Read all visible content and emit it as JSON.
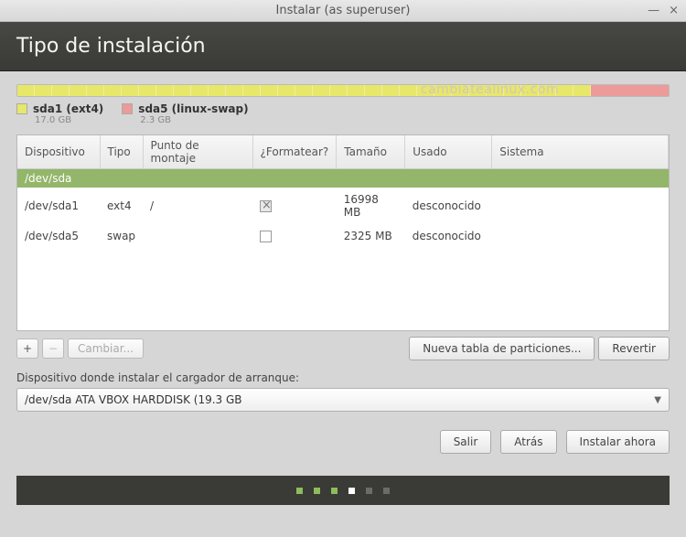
{
  "window": {
    "title": "Instalar (as superuser)"
  },
  "header": {
    "title": "Tipo de instalación"
  },
  "watermark": "cambiatealinux.com",
  "diskBar": {
    "ext4_pct": 88,
    "swap_pct": 12
  },
  "legend": [
    {
      "name": "sda1 (ext4)",
      "size": "17.0 GB",
      "swatch": "ext4"
    },
    {
      "name": "sda5 (linux-swap)",
      "size": "2.3 GB",
      "swatch": "swap"
    }
  ],
  "columns": [
    "Dispositivo",
    "Tipo",
    "Punto de montaje",
    "¿Formatear?",
    "Tamaño",
    "Usado",
    "Sistema"
  ],
  "deviceRow": "/dev/sda",
  "partitions": [
    {
      "device": "/dev/sda1",
      "type": "ext4",
      "mount": "/",
      "format": true,
      "size": "16998 MB",
      "used": "desconocido",
      "system": ""
    },
    {
      "device": "/dev/sda5",
      "type": "swap",
      "mount": "",
      "format": false,
      "size": "2325 MB",
      "used": "desconocido",
      "system": ""
    }
  ],
  "toolbar": {
    "change": "Cambiar...",
    "newTable": "Nueva tabla de particiones...",
    "revert": "Revertir"
  },
  "bootloader": {
    "label": "Dispositivo donde instalar el cargador de arranque:",
    "value": "/dev/sda   ATA VBOX HARDDISK (19.3 GB"
  },
  "buttons": {
    "quit": "Salir",
    "back": "Atrás",
    "install": "Instalar ahora"
  }
}
